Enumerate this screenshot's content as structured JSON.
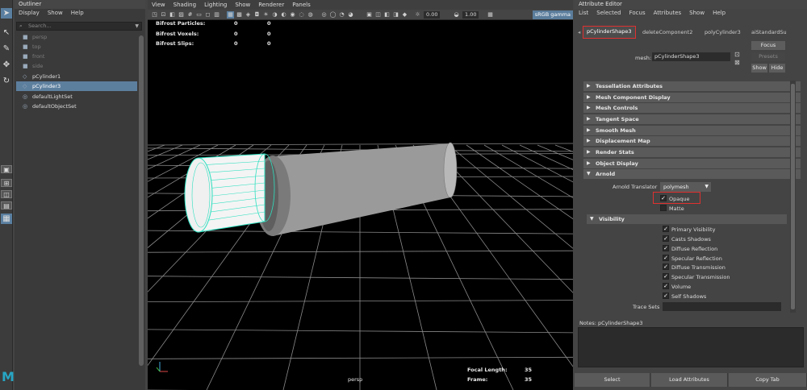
{
  "outliner": {
    "title": "Outliner",
    "menu": [
      "Display",
      "Show",
      "Help"
    ],
    "search_placeholder": "Search...",
    "items": [
      {
        "label": "persp",
        "dim": true
      },
      {
        "label": "top",
        "dim": true
      },
      {
        "label": "front",
        "dim": true
      },
      {
        "label": "side",
        "dim": true
      },
      {
        "label": "pCylinder1",
        "dim": false
      },
      {
        "label": "pCylinder3",
        "dim": false,
        "selected": true
      },
      {
        "label": "defaultLightSet",
        "dim": false
      },
      {
        "label": "defaultObjectSet",
        "dim": false
      }
    ]
  },
  "viewport": {
    "menu": [
      "View",
      "Shading",
      "Lighting",
      "Show",
      "Renderer",
      "Panels"
    ],
    "exposure": "0.00",
    "gamma": "1.00",
    "color_space": "sRGB gamma",
    "hud_rows": [
      {
        "label": "Bifrost Particles:",
        "a": "0",
        "b": "0"
      },
      {
        "label": "Bifrost Voxels:",
        "a": "0",
        "b": "0"
      },
      {
        "label": "Bifrost Slips:",
        "a": "0",
        "b": "0"
      }
    ],
    "camera_name": "persp",
    "focal_length_label": "Focal Length:",
    "focal_length": "35",
    "frame_label": "Frame:",
    "frame": "35",
    "colors": {
      "selection_wire": "#2ee0c0",
      "mesh_gray": "#8f8f8f"
    }
  },
  "attribute_editor": {
    "title": "Attribute Editor",
    "menu": [
      "List",
      "Selected",
      "Focus",
      "Attributes",
      "Show",
      "Help"
    ],
    "tabs": [
      "pCylinderShape3",
      "deleteComponent2",
      "polyCylinder3",
      "aiStandardSu"
    ],
    "mesh_label": "mesh:",
    "mesh_value": "pCylinderShape3",
    "focus_btn": "Focus",
    "presets_btn": "Presets",
    "show_btn": "Show",
    "hide_btn": "Hide",
    "sections": [
      "Tessellation Attributes",
      "Mesh Component Display",
      "Mesh Controls",
      "Tangent Space",
      "Smooth Mesh",
      "Displacement Map",
      "Render Stats",
      "Object Display",
      "Arnold"
    ],
    "arnold_translator_label": "Arnold Translator",
    "arnold_translator_value": "polymesh",
    "opaque_label": "Opaque",
    "matte_label": "Matte",
    "visibility_section": "Visibility",
    "visibility_items": [
      "Primary Visibility",
      "Casts Shadows",
      "Diffuse Reflection",
      "Specular Reflection",
      "Diffuse Transmission",
      "Specular Transmission",
      "Volume",
      "Self Shadows"
    ],
    "trace_sets_label": "Trace Sets",
    "notes_label": "Notes:  pCylinderShape3",
    "bottom_buttons": [
      "Select",
      "Load Attributes",
      "Copy Tab"
    ],
    "highlight_color": "#e03030"
  }
}
